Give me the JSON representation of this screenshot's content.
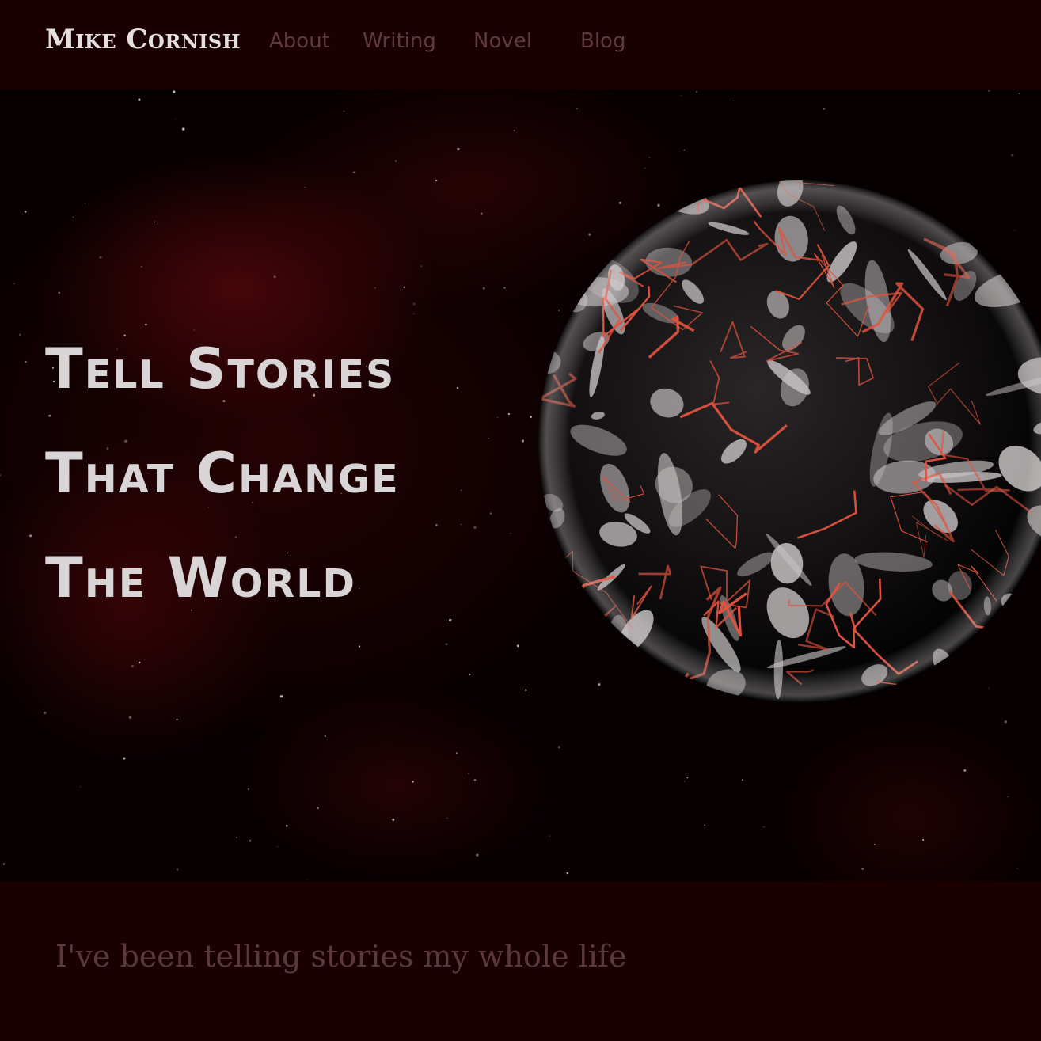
{
  "header": {
    "brand": "Mike Cornish",
    "nav": [
      {
        "label": "About"
      },
      {
        "label": "Writing"
      },
      {
        "label": "Novel"
      },
      {
        "label": "Blog"
      }
    ]
  },
  "hero": {
    "title_lines": [
      "Tell Stories",
      "That Change",
      "The World"
    ],
    "image_description": "cracked-earth-planet"
  },
  "intro": {
    "text": "I've been telling stories my whole life"
  },
  "colors": {
    "page_background": "#1b0002",
    "hero_background": "#060001",
    "title_text": "#d9d4d6",
    "nav_text": "#5e3a3d",
    "intro_text": "#5a383c",
    "lava": "#e0533f"
  }
}
